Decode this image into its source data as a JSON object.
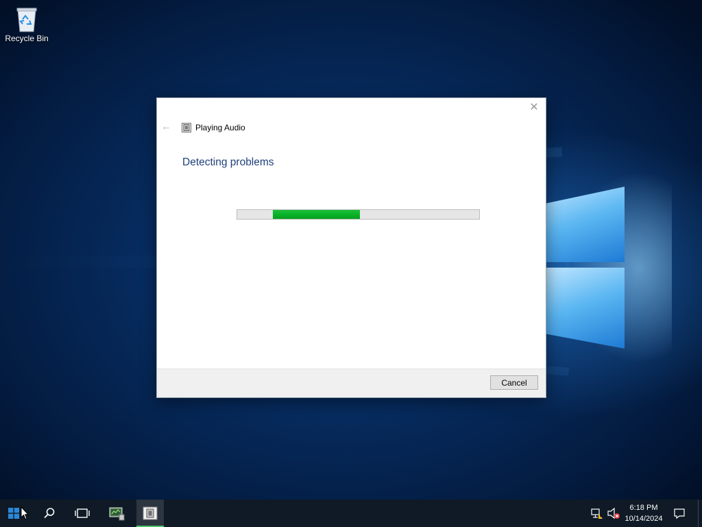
{
  "desktop": {
    "icons": [
      {
        "label": "Recycle Bin",
        "icon": "recycle-bin-icon"
      }
    ]
  },
  "dialog": {
    "title": "Playing Audio",
    "heading": "Detecting problems",
    "progress_label": "progress-indeterminate",
    "cancel_label": "Cancel",
    "close_glyph": "✕",
    "back_glyph": "←"
  },
  "taskbar": {
    "buttons": [
      {
        "name": "start-button",
        "icon": "windows-logo-icon"
      },
      {
        "name": "search-button",
        "icon": "search-icon"
      },
      {
        "name": "task-view-button",
        "icon": "task-view-icon"
      },
      {
        "name": "server-manager-button",
        "icon": "server-manager-icon"
      },
      {
        "name": "troubleshooter-button",
        "icon": "troubleshooter-icon",
        "active": true
      }
    ],
    "tray": {
      "icons": [
        "network-icon",
        "volume-muted-icon"
      ],
      "time": "6:18 PM",
      "date": "10/14/2024",
      "notification_icon": "action-center-icon"
    }
  },
  "colors": {
    "accent_heading": "#1f3f7a",
    "progress_fill": "#06b025",
    "taskbar_bg": "#0f1a26"
  }
}
